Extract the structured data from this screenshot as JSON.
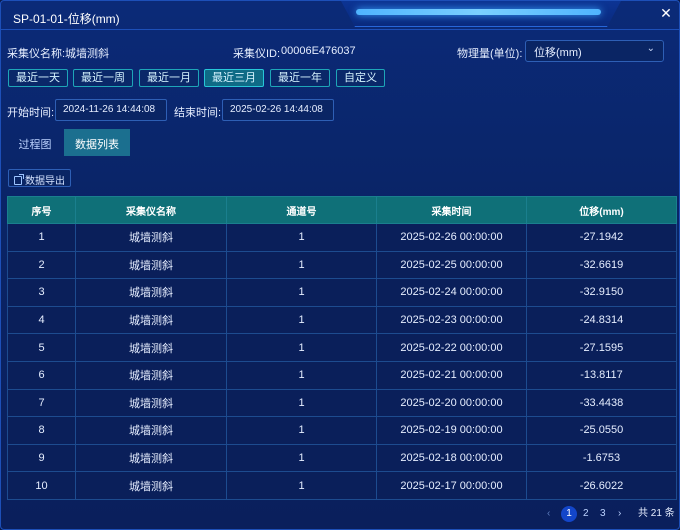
{
  "dialog": {
    "title": "SP-01-01-位移(mm)",
    "close_glyph": "✕"
  },
  "info": {
    "instrument_name_label": "采集仪名称:",
    "instrument_name": "城墙测斜",
    "instrument_id_label": "采集仪ID:",
    "instrument_id": "00006E476037",
    "quantity_label": "物理量(单位):",
    "quantity_value": "位移(mm)"
  },
  "quick_ranges": [
    {
      "label": "最近一天",
      "active": false
    },
    {
      "label": "最近一周",
      "active": false
    },
    {
      "label": "最近一月",
      "active": false
    },
    {
      "label": "最近三月",
      "active": true
    },
    {
      "label": "最近一年",
      "active": false
    },
    {
      "label": "自定义",
      "active": false
    }
  ],
  "time": {
    "start_label": "开始时间:",
    "start_value": "2024-11-26 14:44:08",
    "end_label": "结束时间:",
    "end_value": "2025-02-26 14:44:08"
  },
  "tabs": [
    {
      "label": "过程图",
      "active": false
    },
    {
      "label": "数据列表",
      "active": true
    }
  ],
  "export_label": "数据导出",
  "table": {
    "headers": [
      "序号",
      "采集仪名称",
      "通道号",
      "采集时间",
      "位移(mm)"
    ],
    "rows": [
      [
        "1",
        "城墙测斜",
        "1",
        "2025-02-26 00:00:00",
        "-27.1942"
      ],
      [
        "2",
        "城墙测斜",
        "1",
        "2025-02-25 00:00:00",
        "-32.6619"
      ],
      [
        "3",
        "城墙测斜",
        "1",
        "2025-02-24 00:00:00",
        "-32.9150"
      ],
      [
        "4",
        "城墙测斜",
        "1",
        "2025-02-23 00:00:00",
        "-24.8314"
      ],
      [
        "5",
        "城墙测斜",
        "1",
        "2025-02-22 00:00:00",
        "-27.1595"
      ],
      [
        "6",
        "城墙测斜",
        "1",
        "2025-02-21 00:00:00",
        "-13.8117"
      ],
      [
        "7",
        "城墙测斜",
        "1",
        "2025-02-20 00:00:00",
        "-33.4438"
      ],
      [
        "8",
        "城墙测斜",
        "1",
        "2025-02-19 00:00:00",
        "-25.0550"
      ],
      [
        "9",
        "城墙测斜",
        "1",
        "2025-02-18 00:00:00",
        "-1.6753"
      ],
      [
        "10",
        "城墙测斜",
        "1",
        "2025-02-17 00:00:00",
        "-26.6022"
      ]
    ]
  },
  "pagination": {
    "prev": "‹",
    "pages": [
      "1",
      "2",
      "3"
    ],
    "current": "1",
    "next": "›",
    "total": "共 21 条"
  },
  "colors": {
    "background": "#0a2466",
    "header_row": "#0f7078",
    "active_button": "#0f6b86",
    "accent_border": "#1ea6b8",
    "page_current": "#1346c9"
  }
}
